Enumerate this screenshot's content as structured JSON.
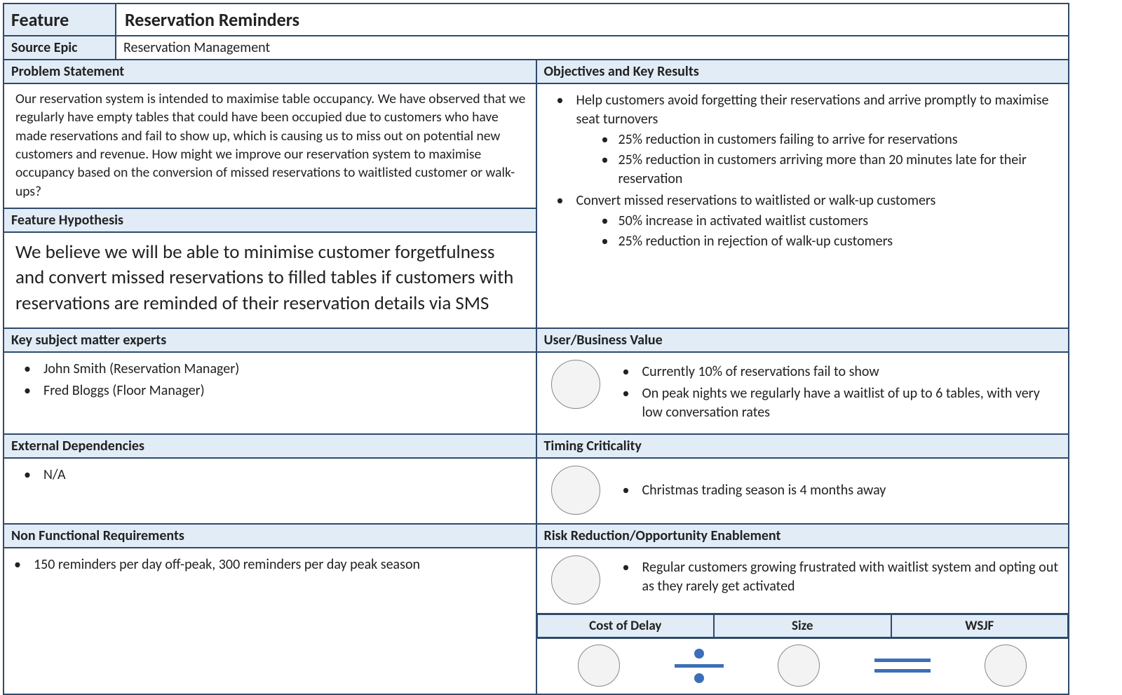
{
  "header": {
    "feature_label": "Feature",
    "feature_value": "Reservation Reminders",
    "source_epic_label": "Source Epic",
    "source_epic_value": "Reservation Management"
  },
  "left": {
    "problem_label": "Problem Statement",
    "problem_text": "Our reservation system is intended to maximise table occupancy. We have observed that we regularly have empty tables that could have been occupied due to customers who have made reservations and fail to show up, which is causing us to miss out on potential new customers and revenue.  How might we improve our reservation system to maximise occupancy based on the conversion of missed reservations to waitlisted customer or walk-ups?",
    "hypothesis_label": "Feature Hypothesis",
    "hypothesis_text": "We believe we will be able to minimise customer forgetfulness and convert missed reservations to filled tables if customers with reservations are reminded of their reservation details via SMS",
    "sme_label": "Key subject matter experts",
    "sme": [
      "John Smith (Reservation Manager)",
      "Fred Bloggs (Floor Manager)"
    ],
    "deps_label": "External Dependencies",
    "deps": [
      "N/A"
    ],
    "nfr_label": "Non Functional Requirements",
    "nfr": [
      "150 reminders per day off-peak, 300 reminders per day peak season"
    ]
  },
  "right": {
    "okr_label": "Objectives and Key Results",
    "okr": [
      {
        "text": "Help customers avoid forgetting their reservations and arrive promptly to maximise seat turnovers",
        "sub": [
          "25% reduction in customers failing to arrive for reservations",
          "25% reduction in customers arriving more than 20 minutes late for their reservation"
        ]
      },
      {
        "text": "Convert missed reservations to waitlisted or walk-up customers",
        "sub": [
          "50% increase in activated waitlist customers",
          "25% reduction in rejection of walk-up customers"
        ]
      }
    ],
    "ubv_label": "User/Business Value",
    "ubv": [
      "Currently 10% of reservations fail to show",
      "On peak nights we regularly have a waitlist of up to 6 tables, with very low conversation rates"
    ],
    "timing_label": "Timing Criticality",
    "timing": [
      "Christmas trading season is 4 months away"
    ],
    "risk_label": "Risk Reduction/Opportunity Enablement",
    "risk": [
      "Regular customers growing frustrated with waitlist system and opting out as they rarely get activated"
    ],
    "wsjf": {
      "cod_label": "Cost of Delay",
      "size_label": "Size",
      "wsjf_label": "WSJF"
    }
  }
}
